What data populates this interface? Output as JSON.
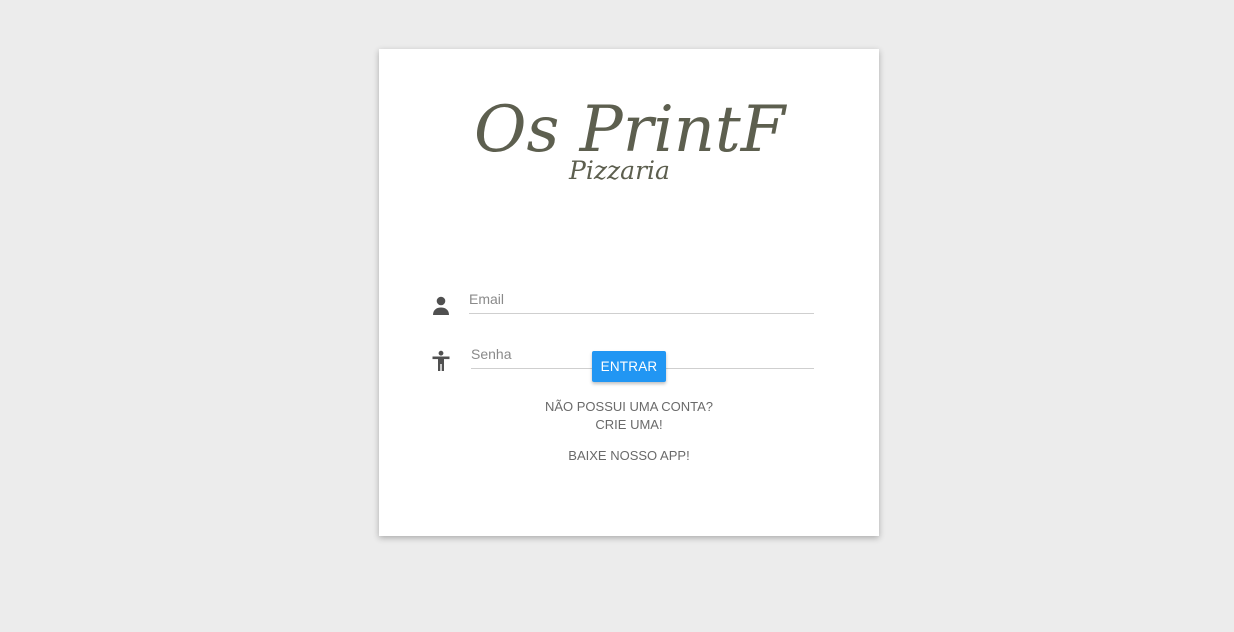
{
  "logo": {
    "main_text": "Os PrintF",
    "sub_text": "Pizzaria",
    "color": "#5d5f4f"
  },
  "form": {
    "email_placeholder": "Email",
    "password_placeholder": "Senha",
    "email_icon": "person-icon",
    "password_icon": "accessibility-icon"
  },
  "actions": {
    "submit_label": "ENTRAR",
    "signup_line1": "NÃO POSSUI UMA CONTA?",
    "signup_line2": "CRIE UMA!",
    "app_label": "BAIXE NOSSO APP!"
  },
  "colors": {
    "background": "#ececec",
    "card": "#ffffff",
    "accent": "#2196f3",
    "text_muted": "#6a6a6a"
  }
}
